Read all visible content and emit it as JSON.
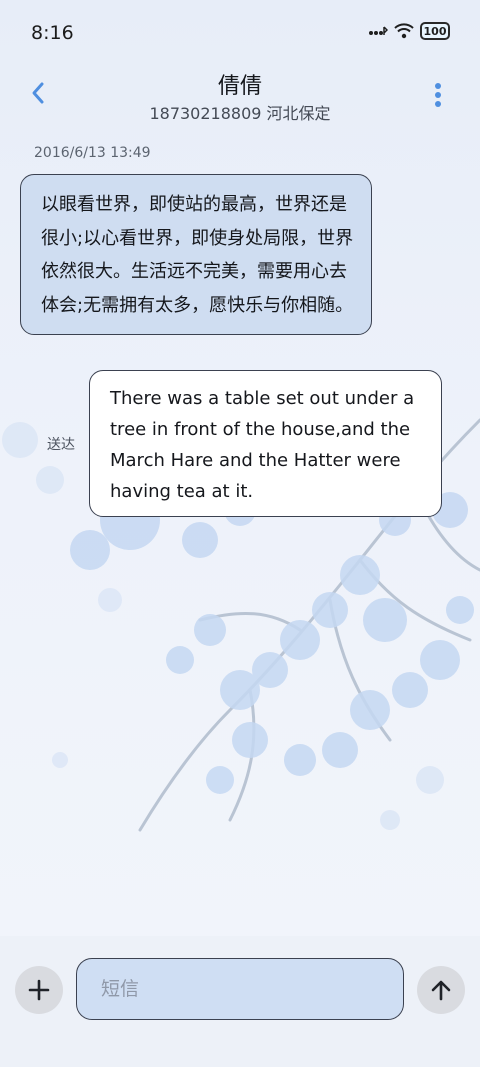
{
  "status_bar": {
    "time": "8:16",
    "battery": "100"
  },
  "header": {
    "contact_name": "倩倩",
    "contact_sub": "18730218809 河北保定"
  },
  "conversation": {
    "timestamp": "2016/6/13 13:49",
    "received_message": "以眼看世界，即使站的最高，世界还是很小;以心看世界，即使身处局限，世界依然很大。生活远不完美，需要用心去体会;无需拥有太多，愿快乐与你相随。",
    "sent_message": "There was a table set out under a tree in front of the house,and the March Hare and the Hatter were having tea at it.",
    "delivery_status": "送达"
  },
  "composer": {
    "placeholder": "短信",
    "value": ""
  },
  "colors": {
    "received_bubble": "#cfddf1",
    "sent_bubble": "#ffffff",
    "input_field": "#cfdef3",
    "accent": "#4f8fe0"
  },
  "icons": {
    "back": "chevron-left-icon",
    "more": "more-vertical-icon",
    "add": "plus-icon",
    "send": "arrow-up-icon"
  }
}
